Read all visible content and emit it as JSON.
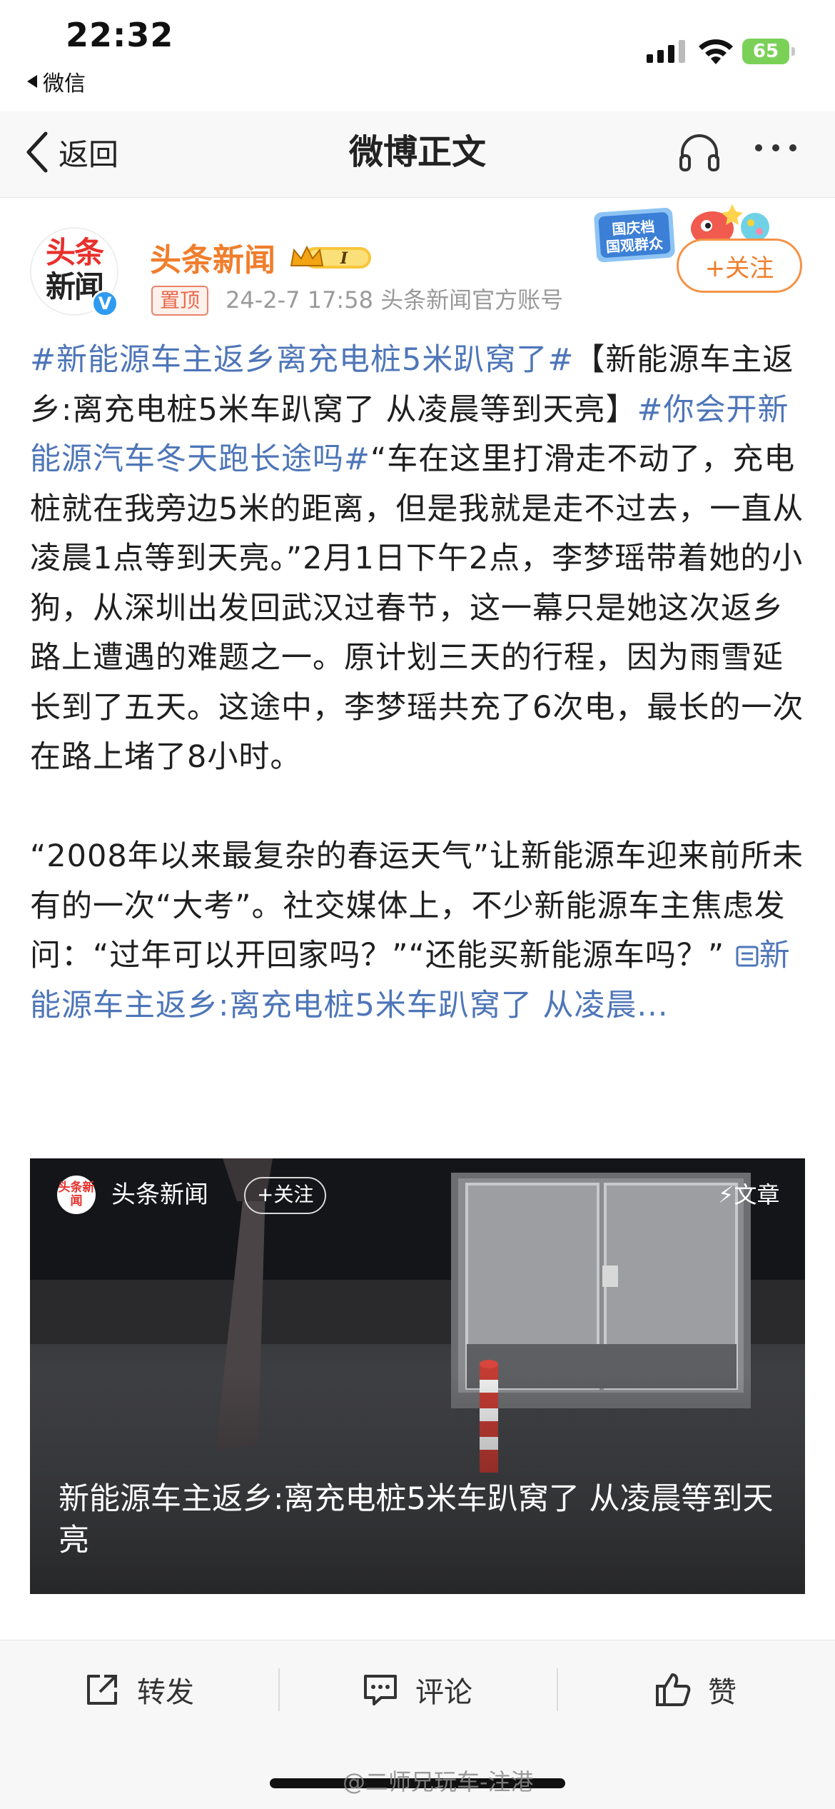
{
  "status": {
    "time": "22:32",
    "back_app": "微信",
    "battery": "65"
  },
  "nav": {
    "back_label": "返回",
    "title": "微博正文"
  },
  "author": {
    "name": "头条新闻",
    "avatar_top": "头条",
    "avatar_bottom": "新闻",
    "level": "I",
    "pinned_label": "置顶",
    "meta": "24-2-7 17:58  头条新闻官方账号",
    "follow_label": "+关注",
    "promo_text": "国庆档 国观群众"
  },
  "post": {
    "hashtag1": "#新能源车主返乡离充电桩5米趴窝了#",
    "text1": "【新能源车主返乡:离充电桩5米车趴窝了 从凌晨等到天亮】",
    "hashtag2": "#你会开新能源汽车冬天跑长途吗#",
    "text2": "“车在这里打滑走不动了，充电桩就在我旁边5米的距离，但是我就是走不过去，一直从凌晨1点等到天亮。”2月1日下午2点，李梦瑶带着她的小狗，从深圳出发回武汉过春节，这一幕只是她这次返乡路上遭遇的难题之一。原计划三天的行程，因为雨雪延长到了五天。这途中，李梦瑶共充了6次电，最长的一次在路上堵了8小时。",
    "text3": "“2008年以来最复杂的春运天气”让新能源车迎来前所未有的一次“大考”。社交媒体上，不少新能源车主焦虑发问：“过年可以开回家吗？”“还能买新能源车吗？”",
    "link_text": "新能源车主返乡:离充电桩5米车趴窝了 从凌晨..."
  },
  "card": {
    "avatar_text": "头条新闻",
    "author": "头条新闻",
    "follow_label": "+关注",
    "article_label": "⚡文章",
    "title": "新能源车主返乡:离充电桩5米车趴窝了 从凌晨等到天亮"
  },
  "actions": {
    "repost": "转发",
    "comment": "评论",
    "like": "赞"
  },
  "watermark": "@二师兄玩车-注港",
  "colors": {
    "link": "#4e76b8",
    "author": "#f07e2c",
    "follow_border": "#f49348"
  }
}
